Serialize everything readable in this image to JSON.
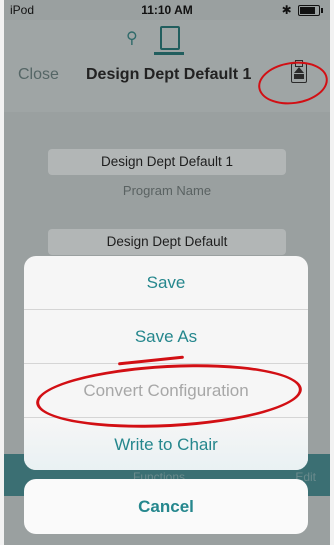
{
  "status_bar": {
    "device": "iPod",
    "time": "11:10 AM",
    "bluetooth": "✱"
  },
  "nav": {
    "close_label": "Close",
    "title": "Design Dept Default 1",
    "icons": [
      "chair-icon",
      "document-icon",
      "clipboard-upload-icon"
    ]
  },
  "form": {
    "program_name_value": "Design Dept Default 1",
    "program_name_label": "Program Name",
    "second_value": "Design Dept Default",
    "functions_label": "Functions",
    "edit_label": "Edit"
  },
  "action_sheet": {
    "items": [
      {
        "label": "Save",
        "enabled": true
      },
      {
        "label": "Save As",
        "enabled": true
      },
      {
        "label": "Convert Configuration",
        "enabled": false
      },
      {
        "label": "Write to Chair",
        "enabled": true
      }
    ],
    "cancel_label": "Cancel"
  },
  "colors": {
    "accent": "#25878d",
    "annotation": "#d20f14"
  }
}
